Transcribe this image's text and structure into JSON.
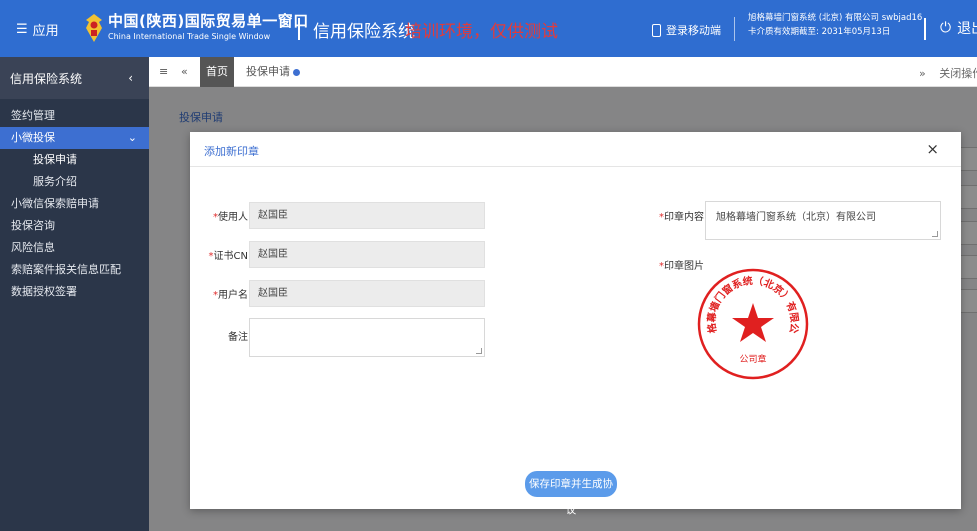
{
  "header": {
    "menu_label": "应用",
    "brand_cn": "中国(陕西)国际贸易单一窗口",
    "brand_en": "China International Trade Single Window",
    "system_title": "信用保险系统",
    "environment_note": "培训环境，仅供测试",
    "mobile_login": "登录移动端",
    "user_line1": "旭格幕墙门窗系统 (北京) 有限公司 swbjad16",
    "user_line2": "卡介质有效期截至: 2031年05月13日",
    "logout": "退出"
  },
  "sidebar": {
    "title": "信用保险系统",
    "items": [
      {
        "label": "签约管理"
      },
      {
        "label": "小微投保"
      },
      {
        "label": "投保申请"
      },
      {
        "label": "服务介绍"
      },
      {
        "label": "小微信保索赔申请"
      },
      {
        "label": "投保咨询"
      },
      {
        "label": "风险信息"
      },
      {
        "label": "索赔案件报关信息匹配"
      },
      {
        "label": "数据授权签署"
      }
    ]
  },
  "tabs": {
    "home": "首页",
    "current": "投保申请",
    "close_ops": "关闭操作"
  },
  "content": {
    "title": "投保申请"
  },
  "modal": {
    "title": "添加新印章",
    "close": "×",
    "user_label": "使用人",
    "user_value": "赵国臣",
    "cert_label": "证书CN",
    "cert_value": "赵国臣",
    "username_label": "用户名",
    "username_value": "赵国臣",
    "remark_label": "备注",
    "remark_value": "",
    "seal_content_label": "印章内容",
    "seal_content_value": "旭格幕墙门窗系统（北京）有限公司",
    "seal_image_label": "印章图片",
    "seal_ring_text": "旭格幕墙门窗系统（北京）有限公司",
    "seal_center_text": "公司章",
    "save_button": "保存印章并生成协议",
    "required_mark": "*"
  },
  "colors": {
    "header_bg": "#2f6dd0",
    "sidebar_bg": "#2b3649",
    "accent": "#3d6fd1",
    "seal_red": "#e02020",
    "required": "#e02d2d"
  }
}
